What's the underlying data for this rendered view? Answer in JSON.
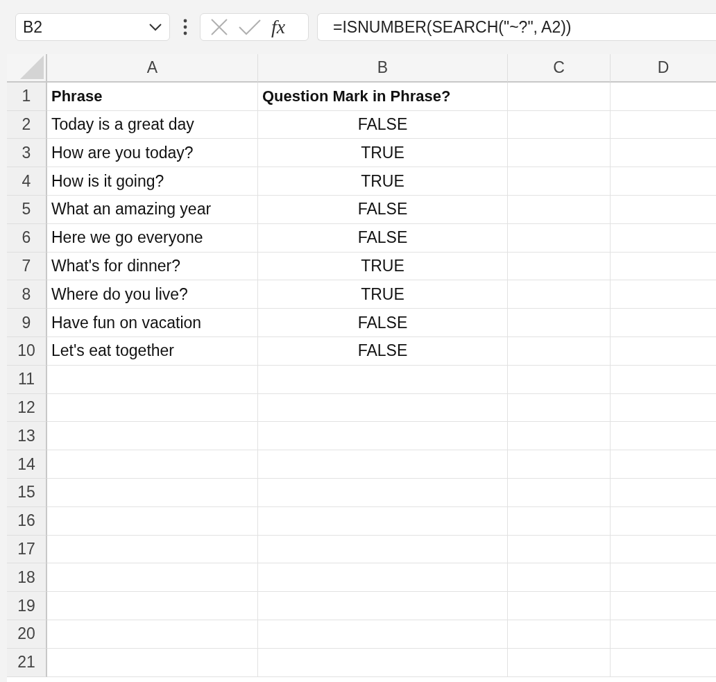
{
  "name_box": {
    "value": "B2"
  },
  "formula_bar": {
    "function_label": "fx",
    "formula": "=ISNUMBER(SEARCH(\"~?\", A2))"
  },
  "columns": [
    "A",
    "B",
    "C",
    "D"
  ],
  "rows": [
    {
      "number": "1",
      "cells": [
        {
          "text": "Phrase",
          "kind": "heading"
        },
        {
          "text": "Question Mark in Phrase?",
          "kind": "heading"
        }
      ]
    },
    {
      "number": "2",
      "cells": [
        {
          "text": "Today is a great day",
          "kind": "text"
        },
        {
          "text": "FALSE",
          "kind": "boolean"
        }
      ]
    },
    {
      "number": "3",
      "cells": [
        {
          "text": "How are you today?",
          "kind": "text"
        },
        {
          "text": "TRUE",
          "kind": "boolean"
        }
      ]
    },
    {
      "number": "4",
      "cells": [
        {
          "text": "How is it going?",
          "kind": "text"
        },
        {
          "text": "TRUE",
          "kind": "boolean"
        }
      ]
    },
    {
      "number": "5",
      "cells": [
        {
          "text": "What an amazing year",
          "kind": "text"
        },
        {
          "text": "FALSE",
          "kind": "boolean"
        }
      ]
    },
    {
      "number": "6",
      "cells": [
        {
          "text": "Here we go everyone",
          "kind": "text"
        },
        {
          "text": "FALSE",
          "kind": "boolean"
        }
      ]
    },
    {
      "number": "7",
      "cells": [
        {
          "text": "What's for dinner?",
          "kind": "text"
        },
        {
          "text": "TRUE",
          "kind": "boolean"
        }
      ]
    },
    {
      "number": "8",
      "cells": [
        {
          "text": "Where do you live?",
          "kind": "text"
        },
        {
          "text": "TRUE",
          "kind": "boolean"
        }
      ]
    },
    {
      "number": "9",
      "cells": [
        {
          "text": "Have fun on vacation",
          "kind": "text"
        },
        {
          "text": "FALSE",
          "kind": "boolean"
        }
      ]
    },
    {
      "number": "10",
      "cells": [
        {
          "text": "Let's eat together",
          "kind": "text"
        },
        {
          "text": "FALSE",
          "kind": "boolean"
        }
      ]
    },
    {
      "number": "11"
    },
    {
      "number": "12"
    },
    {
      "number": "13"
    },
    {
      "number": "14"
    },
    {
      "number": "15"
    },
    {
      "number": "16"
    },
    {
      "number": "17"
    },
    {
      "number": "18"
    },
    {
      "number": "19"
    },
    {
      "number": "20"
    },
    {
      "number": "21"
    }
  ]
}
